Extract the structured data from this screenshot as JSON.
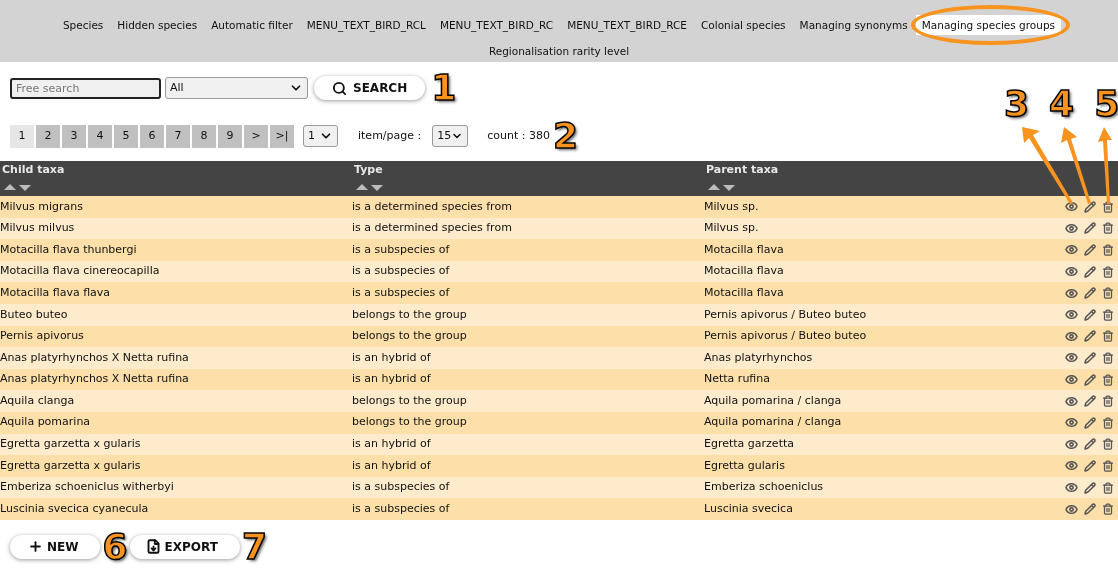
{
  "nav": {
    "tabs": [
      {
        "label": "Species",
        "selected": false
      },
      {
        "label": "Hidden species",
        "selected": false
      },
      {
        "label": "Automatic filter",
        "selected": false
      },
      {
        "label": "MENU_TEXT_BIRD_RCL",
        "selected": false
      },
      {
        "label": "MENU_TEXT_BIRD_RC",
        "selected": false
      },
      {
        "label": "MENU_TEXT_BIRD_RCE",
        "selected": false
      },
      {
        "label": "Colonial species",
        "selected": false
      },
      {
        "label": "Managing synonyms",
        "selected": false
      },
      {
        "label": "Managing species groups",
        "selected": true
      },
      {
        "label": "Regionalisation rarity level",
        "selected": false
      }
    ]
  },
  "search": {
    "placeholder": "Free search",
    "filter": "All",
    "button": "SEARCH"
  },
  "pagination": {
    "pages": [
      {
        "label": "1",
        "selected": true
      },
      {
        "label": "2",
        "selected": false
      },
      {
        "label": "3",
        "selected": false
      },
      {
        "label": "4",
        "selected": false
      },
      {
        "label": "5",
        "selected": false
      },
      {
        "label": "6",
        "selected": false
      },
      {
        "label": "7",
        "selected": false
      },
      {
        "label": "8",
        "selected": false
      },
      {
        "label": "9",
        "selected": false
      },
      {
        "label": ">",
        "selected": false
      },
      {
        "label": ">|",
        "selected": false
      }
    ],
    "page_select": "1",
    "items_label": "item/page :",
    "items_select": "15",
    "count": "count : 380"
  },
  "table": {
    "columns": [
      "Child taxa",
      "Type",
      "Parent taxa"
    ],
    "rows": [
      [
        "Milvus migrans",
        "is a determined species from",
        "Milvus sp."
      ],
      [
        "Milvus milvus",
        "is a determined species from",
        "Milvus sp."
      ],
      [
        "Motacilla flava thunbergi",
        "is a subspecies of",
        "Motacilla flava"
      ],
      [
        "Motacilla flava cinereocapilla",
        "is a subspecies of",
        "Motacilla flava"
      ],
      [
        "Motacilla flava flava",
        "is a subspecies of",
        "Motacilla flava"
      ],
      [
        "Buteo buteo",
        "belongs to the group",
        "Pernis apivorus / Buteo buteo"
      ],
      [
        "Pernis apivorus",
        "belongs to the group",
        "Pernis apivorus / Buteo buteo"
      ],
      [
        "Anas platyrhynchos X Netta rufina",
        "is an hybrid of",
        "Anas platyrhynchos"
      ],
      [
        "Anas platyrhynchos X Netta rufina",
        "is an hybrid of",
        "Netta rufina"
      ],
      [
        "Aquila clanga",
        "belongs to the group",
        "Aquila pomarina / clanga"
      ],
      [
        "Aquila pomarina",
        "belongs to the group",
        "Aquila pomarina / clanga"
      ],
      [
        "Egretta garzetta x gularis",
        "is an hybrid of",
        "Egretta garzetta"
      ],
      [
        "Egretta garzetta x gularis",
        "is an hybrid of",
        "Egretta gularis"
      ],
      [
        "Emberiza schoeniclus witherbyi",
        "is a subspecies of",
        "Emberiza schoeniclus"
      ],
      [
        "Luscinia svecica cyanecula",
        "is a subspecies of",
        "Luscinia svecica"
      ]
    ]
  },
  "actions": {
    "new": "NEW",
    "export": "EXPORT"
  },
  "callouts": [
    "1",
    "2",
    "3",
    "4",
    "5",
    "6",
    "7"
  ]
}
